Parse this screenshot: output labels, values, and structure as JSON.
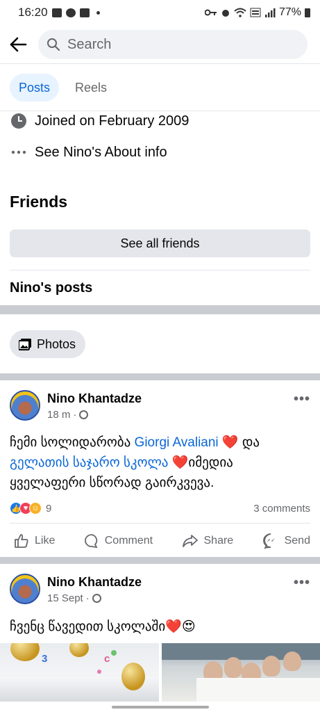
{
  "status_bar": {
    "time": "16:20",
    "battery": "77%"
  },
  "search": {
    "placeholder": "Search"
  },
  "tabs": [
    {
      "label": "Posts",
      "active": true
    },
    {
      "label": "Reels",
      "active": false
    }
  ],
  "about": {
    "joined": "Joined on February 2009",
    "see_about": "See Nino's About info"
  },
  "friends": {
    "title": "Friends",
    "see_all": "See all friends"
  },
  "posts_section": {
    "title": "Nino's posts",
    "photos_chip": "Photos"
  },
  "posts": [
    {
      "author": "Nino Khantadze",
      "time": "18 m",
      "text_part1": "ჩემი სოლიდარობა ",
      "link1": "Giorgi Avaliani",
      "text_part2": " ❤️  და",
      "link2": "გელათის საჯარო სკოლა",
      "text_part3": " ❤️იმედია ყველაფერი სწორად გაირკვევა.",
      "reaction_count": "9",
      "comments": "3 comments"
    },
    {
      "author": "Nino Khantadze",
      "time": "15 Sept",
      "text": "ჩვენც წავედით სკოლაში❤️😍"
    }
  ],
  "actions": {
    "like": "Like",
    "comment": "Comment",
    "share": "Share",
    "send": "Send"
  },
  "colors": {
    "accent": "#0a66d8",
    "tab_active_bg": "#e7f3ff",
    "gray_button": "#e4e6eb",
    "divider": "#c9ccd1"
  }
}
